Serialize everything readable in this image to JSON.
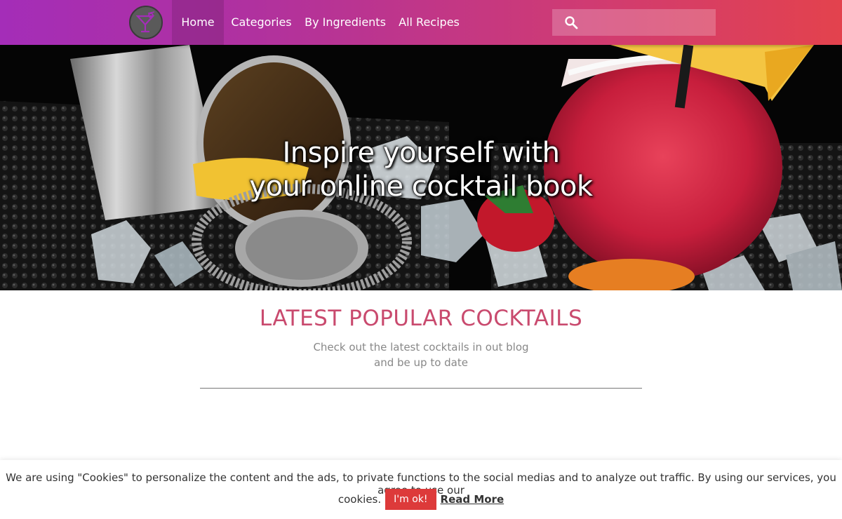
{
  "nav": {
    "logo_icon": "cocktail-glass-icon",
    "items": [
      {
        "label": "Home",
        "active": true
      },
      {
        "label": "Categories",
        "active": false
      },
      {
        "label": "By Ingredients",
        "active": false
      },
      {
        "label": "All Recipes",
        "active": false
      }
    ],
    "search": {
      "placeholder": "",
      "value": "",
      "icon": "search-icon"
    },
    "gradient_colors": [
      "#a42db8",
      "#e3424d"
    ]
  },
  "hero": {
    "title_line1": "Inspire yourself with",
    "title_line2": "your online cocktail book",
    "image_icon": "cocktail-hero-image"
  },
  "section": {
    "title": "LATEST POPULAR COCKTAILS",
    "subtitle_line1": "Check out the latest cocktails in out blog",
    "subtitle_line2": "and be up to date",
    "accent_color": "#c94a6e"
  },
  "cookie": {
    "text_line1": "We are using \"Cookies\" to personalize the content and the ads, to private functions to the social medias and to analyze out traffic. By using our services, you agree to use our",
    "text_line2": "cookies.",
    "ok_button": "I'm ok!",
    "read_more": "Read More",
    "button_color": "#dd3a3a"
  }
}
